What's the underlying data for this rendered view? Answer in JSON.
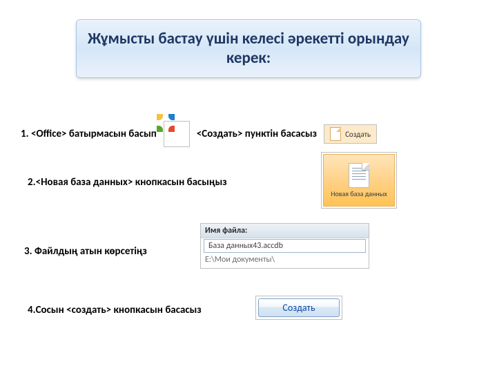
{
  "title": "Жұмысты бастау үшін келесі  әрекетті орындау керек:",
  "steps": {
    "s1a": "1. <Office> батырмасын басып",
    "s1b": "<Создать> пунктін басасыз",
    "s2": "2.<Новая база данных>   кнопкасын  басыңыз",
    "s3": "3. Файлдың атын көрсетіңз",
    "s4": "4.Сосын <создать>  кнопкасын басасыз"
  },
  "menu_create": {
    "label": "Создать"
  },
  "ribbon_button": {
    "label": "Новая база данных"
  },
  "filename_panel": {
    "header": "Имя файла:",
    "value": "База данных43.accdb",
    "path": "E:\\Мои документы\\"
  },
  "pushbutton": {
    "label": "Создать"
  }
}
